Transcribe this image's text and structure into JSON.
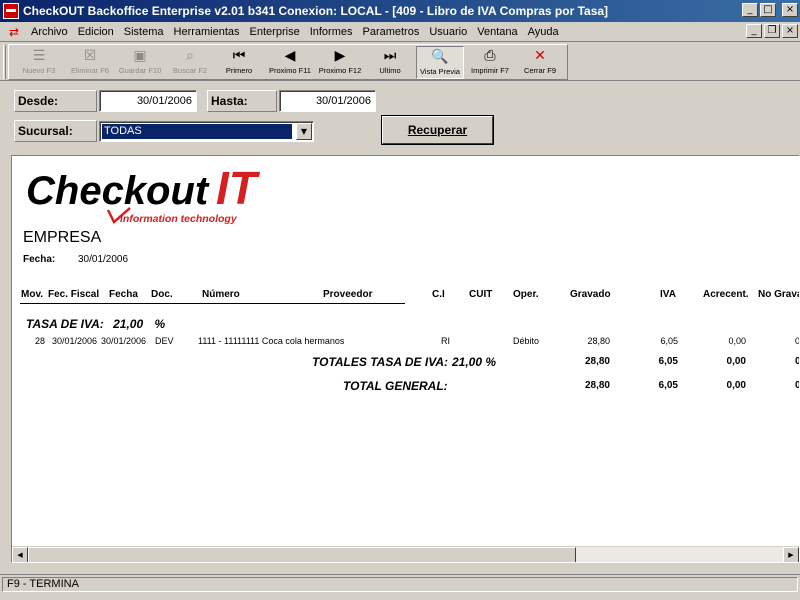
{
  "window": {
    "title": "CheckOUT Backoffice Enterprise v2.01 b341 Conexion: LOCAL - [409 - Libro de IVA Compras por Tasa]",
    "minimize_glyph": "_",
    "maximize_glyph": "□",
    "restore_glyph": "❐",
    "close_glyph": "×"
  },
  "menu": {
    "items": [
      "Archivo",
      "Edicion",
      "Sistema",
      "Herramientas",
      "Enterprise",
      "Informes",
      "Parametros",
      "Usuario",
      "Ventana",
      "Ayuda"
    ]
  },
  "toolbar": {
    "buttons": [
      {
        "label": "Nuevo F3",
        "icon": "new-record-icon",
        "glyph": "☰",
        "enabled": false
      },
      {
        "label": "Eliminar F6",
        "icon": "delete-record-icon",
        "glyph": "☒",
        "enabled": false
      },
      {
        "label": "Guardar F10",
        "icon": "save-icon",
        "glyph": "▣",
        "enabled": false
      },
      {
        "label": "Buscar F2",
        "icon": "binoculars-icon",
        "glyph": "⌕",
        "enabled": false
      },
      {
        "label": "Primero",
        "icon": "first-icon",
        "glyph": "⏮",
        "enabled": true
      },
      {
        "label": "Proximo F11",
        "icon": "previous-icon",
        "glyph": "◀",
        "enabled": true
      },
      {
        "label": "Proximo F12",
        "icon": "next-icon",
        "glyph": "▶",
        "enabled": true
      },
      {
        "label": "Ultimo",
        "icon": "last-icon",
        "glyph": "⏭",
        "enabled": true
      },
      {
        "label": "Vista Previa",
        "icon": "preview-icon",
        "glyph": "🔍",
        "enabled": true,
        "pressed": true
      },
      {
        "label": "Imprimir F7",
        "icon": "printer-icon",
        "glyph": "⎙",
        "enabled": true
      },
      {
        "label": "Cerrar F9",
        "icon": "close-icon",
        "glyph": "✕",
        "enabled": true
      }
    ]
  },
  "filters": {
    "desde_label": "Desde:",
    "desde_value": "30/01/2006",
    "hasta_label": "Hasta:",
    "hasta_value": "30/01/2006",
    "sucursal_label": "Sucursal:",
    "sucursal_value": "TODAS",
    "dropdown_glyph": "▼",
    "recuperar_label": "Recuperar"
  },
  "report": {
    "logo_main": "Checkout",
    "logo_it": "IT",
    "logo_sub": "information technology",
    "empresa": "EMPRESA",
    "fecha_label": "Fecha:",
    "fecha_value": "30/01/2006",
    "columns": [
      "Mov.",
      "Fec. Fiscal",
      "Fecha",
      "Doc.",
      "Número",
      "Proveedor",
      "C.I",
      "CUIT",
      "Oper.",
      "Gravado",
      "IVA",
      "Acrecent.",
      "No Grava"
    ],
    "group_label": "TASA DE IVA:",
    "group_rate": "21,00",
    "group_pct": "%",
    "row": {
      "mov": "28",
      "fec_fiscal": "30/01/2006",
      "fecha": "30/01/2006",
      "doc": "DEV",
      "numero_proveedor": "1111 - 11111111 Coca cola hermanos",
      "ci": "RI",
      "oper": "Débito",
      "gravado": "28,80",
      "iva": "6,05",
      "acrecent": "0,00",
      "no_grava": "0"
    },
    "subtotal": {
      "label": "TOTALES TASA DE IVA:",
      "rate": "21,00 %",
      "gravado": "28,80",
      "iva": "6,05",
      "acrecent": "0,00",
      "no_grava": "0"
    },
    "total": {
      "label": "TOTAL GENERAL:",
      "gravado": "28,80",
      "iva": "6,05",
      "acrecent": "0,00",
      "no_grava": "0"
    }
  },
  "scroll": {
    "left_glyph": "◀",
    "right_glyph": "▶"
  },
  "status": {
    "text": "F9 - TERMINA"
  }
}
